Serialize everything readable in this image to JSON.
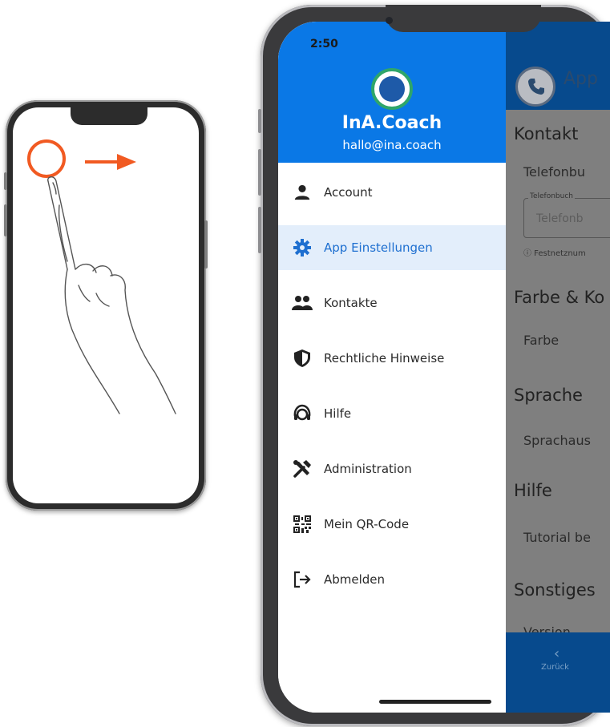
{
  "status_bar": {
    "time": "2:50"
  },
  "drawer": {
    "brand": "InA.Coach",
    "email": "hallo@ina.coach",
    "items": [
      {
        "label": "Account",
        "icon": "person-icon"
      },
      {
        "label": "App Einstellungen",
        "icon": "gear-icon",
        "active": true
      },
      {
        "label": "Kontakte",
        "icon": "people-icon"
      },
      {
        "label": "Rechtliche Hinweise",
        "icon": "shield-icon"
      },
      {
        "label": "Hilfe",
        "icon": "support-icon"
      },
      {
        "label": "Administration",
        "icon": "tools-icon"
      },
      {
        "label": "Mein QR-Code",
        "icon": "qr-code-icon"
      },
      {
        "label": "Abmelden",
        "icon": "logout-icon"
      }
    ],
    "colors": {
      "header": "#0a78e6",
      "active_bg": "#e3eefb",
      "active_text": "#1e6fd0"
    }
  },
  "app_behind": {
    "title": "App",
    "section_kontakt": "Kontakt",
    "telefon_label": "Telefonbu",
    "field_label": "Telefonbuch",
    "field_placeholder": "Telefonb",
    "field_hint": "ⓘ Festnetznum",
    "section_farbe": "Farbe & Ko",
    "farbe_label": "Farbe",
    "section_sprache": "Sprache",
    "sprache_label": "Sprachaus",
    "section_hilfe": "Hilfe",
    "tutorial_label": "Tutorial be",
    "section_sonstiges": "Sonstiges",
    "version_label": "Version",
    "back_label": "Zurück",
    "colors": {
      "header": "#074a8d",
      "overlay": "#7f7f7f"
    }
  },
  "gesture": {
    "colors": {
      "accent": "#f15a22"
    }
  }
}
